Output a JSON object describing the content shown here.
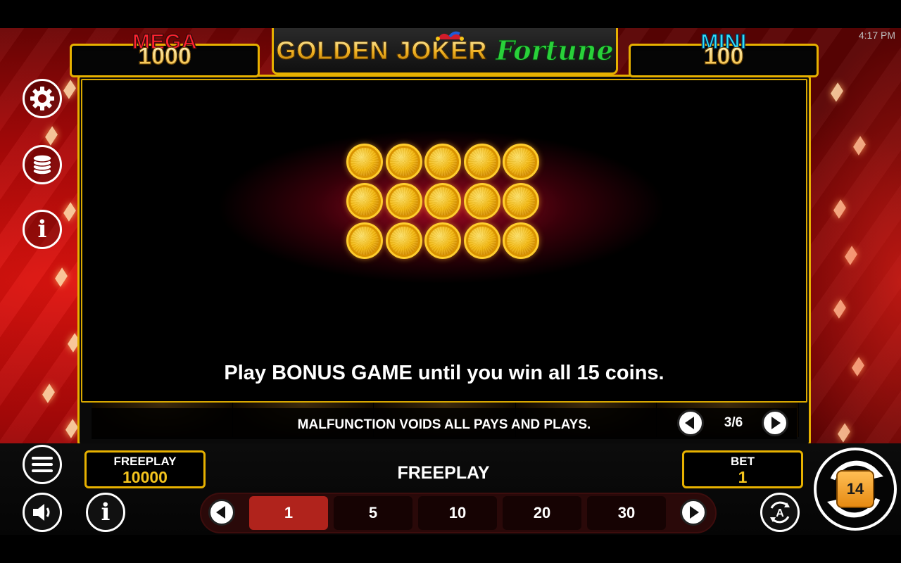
{
  "status_bar": {
    "time": "4:17 PM"
  },
  "jackpots": {
    "mega": {
      "label": "MEGA",
      "value": "1000"
    },
    "mini": {
      "label": "MINI",
      "value": "100"
    }
  },
  "logo": {
    "word1": "GOLDEN JOKER",
    "word2": "Fortune"
  },
  "paytable": {
    "coin_count": 15,
    "grid": {
      "rows": 3,
      "cols": 5
    },
    "text": "Play BONUS GAME until you win all 15 coins.",
    "page": "3/6"
  },
  "info_bar": {
    "message": "MALFUNCTION VOIDS ALL PAYS AND PLAYS."
  },
  "balance": {
    "label": "FREEPLAY",
    "value": "10000"
  },
  "mode_label": "FREEPLAY",
  "bet": {
    "label": "BET",
    "value": "1"
  },
  "bet_options": [
    "1",
    "5",
    "10",
    "20",
    "30"
  ],
  "selected_bet": "1",
  "spin_badge": "14",
  "icons": {
    "settings": "gear-icon",
    "bets": "coin-stack-icon",
    "info": "info-icon",
    "menu": "hamburger-menu-icon",
    "sound": "speaker-icon",
    "autoplay": "autoplay-a-icon",
    "spin": "spin-arrows-icon"
  },
  "colors": {
    "gold_border": "#e7b100",
    "mega": "#ff2330",
    "mini": "#2ee0ff",
    "active_bet": "#b0231c",
    "value_text": "#f4c41d"
  }
}
